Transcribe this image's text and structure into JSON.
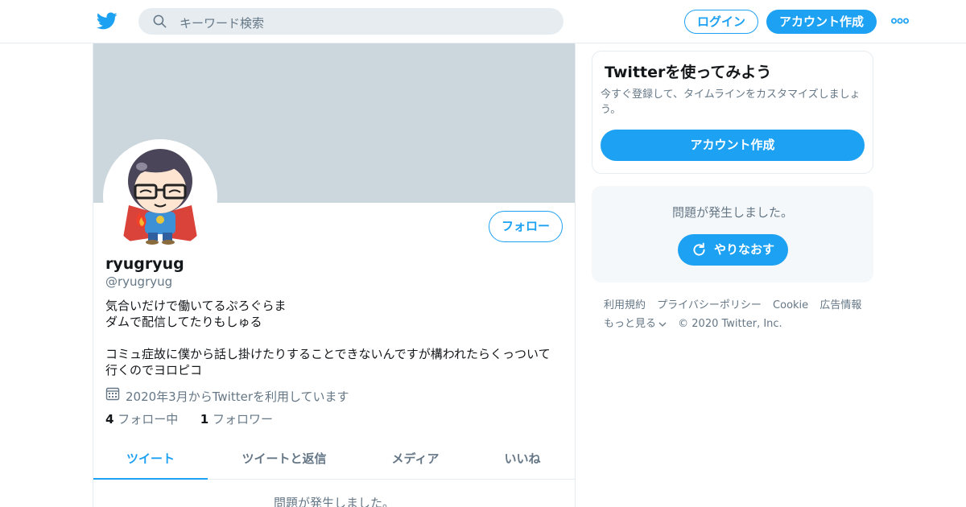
{
  "header": {
    "logo_icon": "twitter-bird-icon",
    "search_placeholder": "キーワード検索",
    "login_label": "ログイン",
    "signup_label": "アカウント作成",
    "more_icon": "more-dots-icon"
  },
  "colors": {
    "accent": "#1da1f2",
    "banner": "#ccd6dd",
    "muted_text": "#657786"
  },
  "profile": {
    "follow_label": "フォロー",
    "display_name": "ryugryug",
    "handle": "@ryugryug",
    "bio_lines": [
      "気合いだけで働いてるぷろぐらま",
      "ダムで配信してたりもしゅる",
      "",
      "コミュ症故に僕から話し掛けたりすることできないんですが構われたらくっついて",
      "行くのでヨロピコ"
    ],
    "joined_icon": "calendar-icon",
    "joined": "2020年3月からTwitterを利用しています",
    "following_count": "4",
    "following_label": "フォロー中",
    "followers_count": "1",
    "followers_label": "フォロワー"
  },
  "tabs": [
    {
      "label": "ツイート",
      "active": true
    },
    {
      "label": "ツイートと返信",
      "active": false
    },
    {
      "label": "メディア",
      "active": false
    },
    {
      "label": "いいね",
      "active": false
    }
  ],
  "timeline_error": "問題が発生しました。",
  "sidebar": {
    "join_title": "Twitterを使ってみよう",
    "join_text": "今すぐ登録して、タイムラインをカスタマイズしましょう。",
    "join_button": "アカウント作成",
    "error_text": "問題が発生しました。",
    "retry_label": "やりなおす",
    "retry_icon": "refresh-icon"
  },
  "footer": {
    "links": [
      "利用規約",
      "プライバシーポリシー",
      "Cookie",
      "広告情報"
    ],
    "more_label": "もっと見る",
    "copyright": "© 2020 Twitter, Inc."
  }
}
